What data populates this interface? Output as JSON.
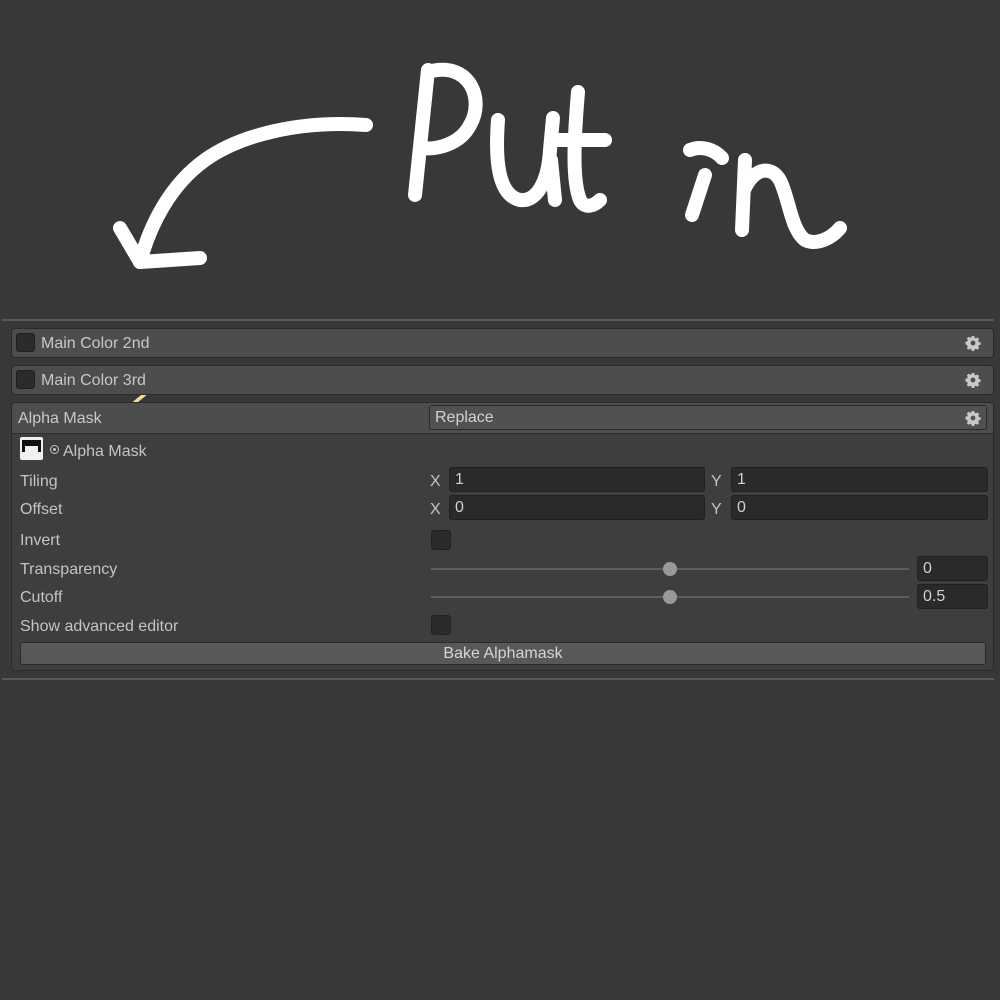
{
  "annotation": {
    "text": "Put in",
    "colors": {
      "arrow": "#ffffff",
      "highlight": "#f5e07a"
    }
  },
  "sections": [
    {
      "label": "Main Color 2nd",
      "enabled": false
    },
    {
      "label": "Main Color 3rd",
      "enabled": false
    }
  ],
  "alpha_mask": {
    "header_label": "Alpha Mask",
    "mode_value": "Replace",
    "texture_label": "Alpha Mask",
    "tiling": {
      "label": "Tiling",
      "x_label": "X",
      "x": "1",
      "y_label": "Y",
      "y": "1"
    },
    "offset": {
      "label": "Offset",
      "x_label": "X",
      "x": "0",
      "y_label": "Y",
      "y": "0"
    },
    "invert": {
      "label": "Invert",
      "checked": false
    },
    "transparency": {
      "label": "Transparency",
      "value": "0",
      "slider_fraction": 0.5
    },
    "cutoff": {
      "label": "Cutoff",
      "value": "0.5",
      "slider_fraction": 0.5
    },
    "advanced": {
      "label": "Show advanced editor",
      "checked": false
    },
    "bake_button": "Bake Alphamask"
  },
  "colors": {
    "background": "#383838",
    "header": "#4d4d4d",
    "field": "#2a2a2a",
    "text": "#c4c4c4"
  },
  "icons": [
    "gear-icon",
    "texture-thumbnail",
    "object-picker-icon"
  ]
}
